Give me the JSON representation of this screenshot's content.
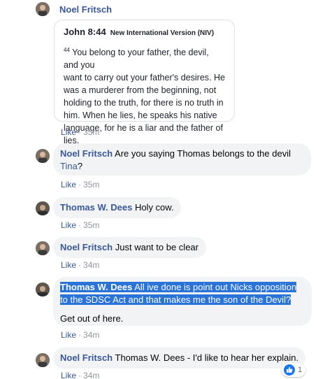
{
  "comments": [
    {
      "author": "Noel Fritsch",
      "verse": {
        "reference": "John 8:44",
        "version": "New International Version (NIV)",
        "verse_number": "44",
        "lines": [
          "You belong to your father, the devil, and you",
          "want to carry out your father's desires. He",
          "was a murderer from the beginning, not",
          "holding to the truth, for there is no truth in",
          "him. When he lies, he speaks his native",
          "language, for he is a liar and the father of lies."
        ]
      },
      "like_label": "Like",
      "time": "35m"
    },
    {
      "author": "Noel Fritsch",
      "text_line1": "Are you saying Thomas belongs to the devil",
      "mention": "Tina",
      "text_line2_tail": "?",
      "like_label": "Like",
      "time": "35m"
    },
    {
      "author": "Thomas W. Dees",
      "text": "Holy cow.",
      "like_label": "Like",
      "time": "35m"
    },
    {
      "author": "Noel Fritsch",
      "text": "Just want to be clear",
      "like_label": "Like",
      "time": "34m"
    },
    {
      "author": "Thomas W. Dees",
      "text_line1": "All ive done is point out Nicks opposition",
      "text_line2": "to the SDSC Act and that makes me the son of the Devil?",
      "text_para2": "Get out of here.",
      "like_label": "Like",
      "time": "34m"
    },
    {
      "author": "Noel Fritsch",
      "mention": "Thomas W. Dees",
      "text": "- I'd like to hear her explain.",
      "like_label": "Like",
      "time": "34m",
      "reaction_count": "1"
    }
  ],
  "separator": "·",
  "colors": {
    "link": "#385898",
    "bubble": "#f2f3f5",
    "highlight": "#2a73d8",
    "meta": "#90949c",
    "like_blue": "#1877f2"
  },
  "icons": {
    "avatar": "profile-photo",
    "reaction": "thumbs-up-icon"
  }
}
